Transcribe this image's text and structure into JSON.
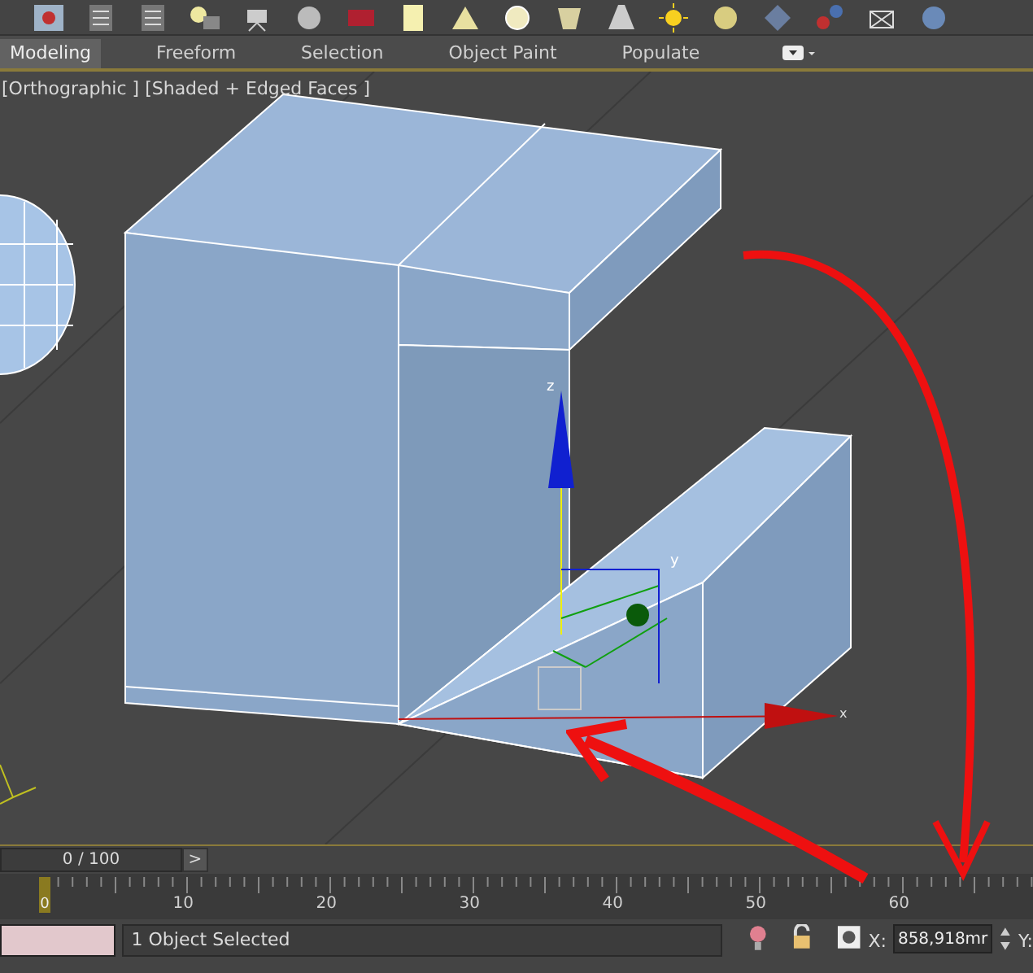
{
  "ribbon_tabs": [
    {
      "label": "Modeling",
      "selected": true
    },
    {
      "label": "Freeform",
      "selected": false
    },
    {
      "label": "Selection",
      "selected": false
    },
    {
      "label": "Object Paint",
      "selected": false
    },
    {
      "label": "Populate",
      "selected": false
    }
  ],
  "viewport": {
    "label": "[Orthographic ] [Shaded + Edged Faces ]",
    "gizmo_labels": [
      "z",
      "y",
      "x"
    ]
  },
  "timeline": {
    "frame": "0 / 100",
    "next": ">",
    "current_frame": "0",
    "ruler_labels": [
      "10",
      "20",
      "30",
      "40",
      "50",
      "60"
    ]
  },
  "status_bar": {
    "message": "1 Object Selected",
    "x_label": "X:",
    "x_value": "858,918mr",
    "y_label": "Y:"
  }
}
